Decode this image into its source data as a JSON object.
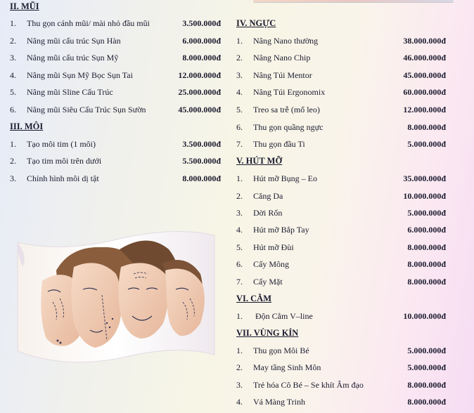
{
  "sections": {
    "mui": {
      "heading": "II. MŨI",
      "items": [
        {
          "num": "1.",
          "name": "Thu gọn cánh mũi/ mài nhỏ đầu mũi",
          "price": "3.500.000đ"
        },
        {
          "num": "2.",
          "name": "Nâng mũi cấu trúc Sụn Hàn",
          "price": "6.000.000đ"
        },
        {
          "num": "3.",
          "name": "Nâng mũi cấu trúc Sụn Mỹ",
          "price": "8.000.000đ"
        },
        {
          "num": "4.",
          "name": "Nâng mũi Sụn Mỹ Bọc Sụn Tai",
          "price": "12.000.000đ"
        },
        {
          "num": "5.",
          "name": "Nâng mũi Sline Cấu Trúc",
          "price": "25.000.000đ"
        },
        {
          "num": "6.",
          "name": "Nâng mũi Siêu Cấu Trúc Sụn Sườn",
          "price": "45.000.000đ"
        }
      ]
    },
    "moi": {
      "heading": "III. MÔI",
      "items": [
        {
          "num": "1.",
          "name": "Tạo môi tim (1 môi)",
          "price": "3.500.000đ"
        },
        {
          "num": "2.",
          "name": "Tạo tim môi trên dưới",
          "price": "5.500.000đ"
        },
        {
          "num": "3.",
          "name": "Chỉnh hình môi dị tật",
          "price": "8.000.000đ"
        }
      ]
    },
    "nguc": {
      "heading": "IV. NGỰC",
      "items": [
        {
          "num": "1.",
          "name": "Nâng Nano thường",
          "price": "38.000.000đ"
        },
        {
          "num": "2.",
          "name": "Nâng Nano Chip",
          "price": "46.000.000đ"
        },
        {
          "num": "3.",
          "name": "Nâng Túi Mentor",
          "price": "45.000.000đ"
        },
        {
          "num": "4.",
          "name": "Nâng Túi Ergonomix",
          "price": "60.000.000đ"
        },
        {
          "num": "5.",
          "name": "Treo sa trễ (mổ leo)",
          "price": "12.000.000đ"
        },
        {
          "num": "6.",
          "name": "Thu gọn quầng ngực",
          "price": "8.000.000đ"
        },
        {
          "num": "7.",
          "name": "Thu gọn đầu Ti",
          "price": "5.000.000đ"
        }
      ]
    },
    "hutmo": {
      "heading": "V. HÚT MỠ",
      "items": [
        {
          "num": "1.",
          "name": "Hút mỡ Bụng – Eo",
          "price": "35.000.000đ"
        },
        {
          "num": "2.",
          "name": "Căng Da",
          "price": "10.000.000đ"
        },
        {
          "num": "3.",
          "name": "Dời Rốn",
          "price": "5.000.000đ"
        },
        {
          "num": "4.",
          "name": "Hút mỡ Bắp Tay",
          "price": "6.000.000đ"
        },
        {
          "num": "5.",
          "name": "Hút mỡ Đùi",
          "price": "8.000.000đ"
        },
        {
          "num": "6.",
          "name": "Cấy Mông",
          "price": "8.000.000đ"
        },
        {
          "num": "7.",
          "name": "Cấy Mặt",
          "price": "8.000.000đ"
        }
      ]
    },
    "cam": {
      "heading": "VI. CẰM",
      "items": [
        {
          "num": "1.",
          "name": "Độn Cằm V–line",
          "price": "10.000.000đ"
        }
      ]
    },
    "vungkin": {
      "heading": "VII. VÙNG KÍN",
      "items": [
        {
          "num": "1.",
          "name": "Thu gọn Môi Bé",
          "price": "5.000.000đ"
        },
        {
          "num": "2.",
          "name": "May tầng Sinh Môn",
          "price": "5.000.000đ"
        },
        {
          "num": "3.",
          "name": "Trẻ hóa Cô Bé – Se khít Âm đạo",
          "price": "8.000.000đ"
        },
        {
          "num": "4.",
          "name": "Vá Màng Trinh",
          "price": "8.000.000đ"
        }
      ]
    }
  },
  "colors": {
    "text": "#1a1a2e",
    "skin": "#efcbb4",
    "hair": "#7a5236",
    "markings": "#3a3a55"
  },
  "icons": [
    "face-contour-illustration"
  ]
}
